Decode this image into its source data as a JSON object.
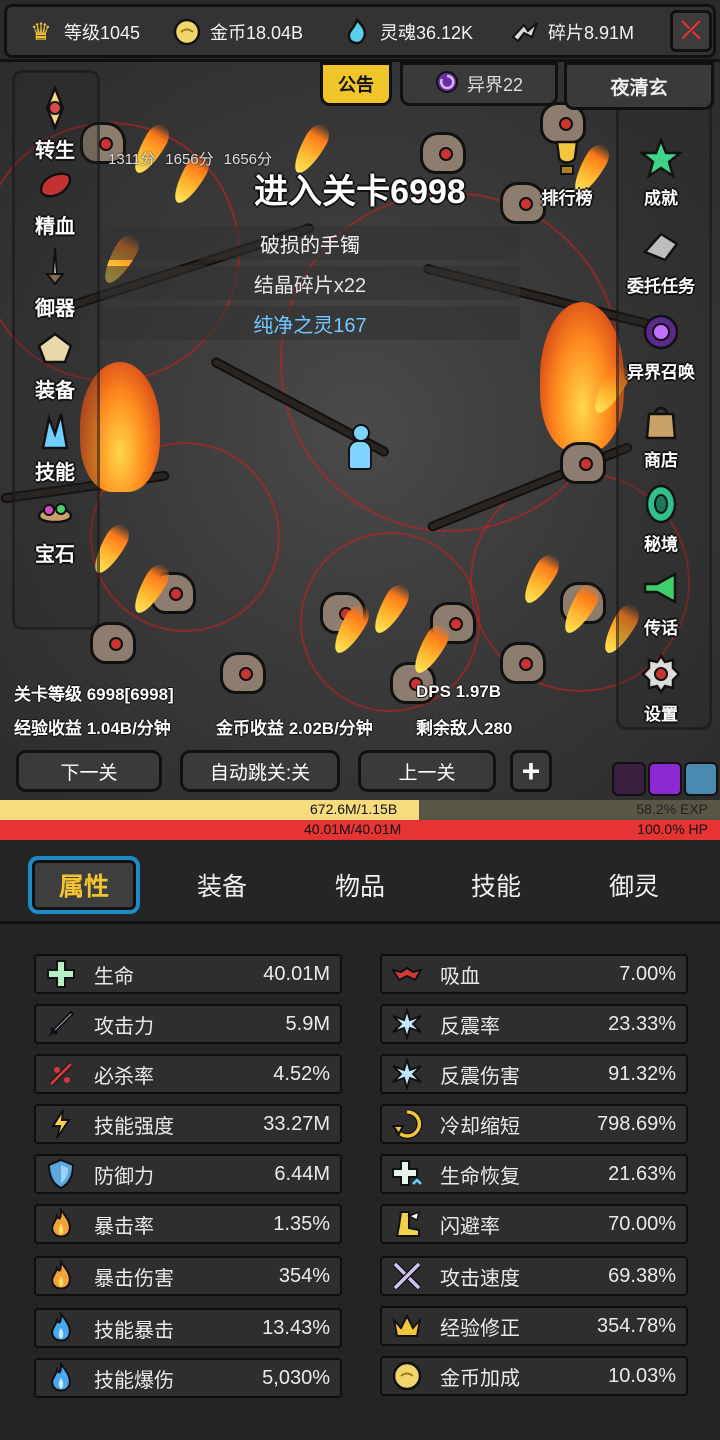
{
  "topbar": {
    "level": {
      "label": "等级1045",
      "icon": "crown-icon"
    },
    "gold": {
      "label": "金币18.04B",
      "icon": "gold-coin-icon"
    },
    "soul": {
      "label": "灵魂36.12K",
      "icon": "soul-flame-icon"
    },
    "shards": {
      "label": "碎片8.91M",
      "icon": "shard-icon"
    },
    "exit_icon": "exit-icon"
  },
  "scene": {
    "notice_label": "公告",
    "realm_label": "异界22",
    "player_name": "夜清玄",
    "scores": [
      "1311分",
      "1656分",
      "1656分"
    ],
    "stage_title": "进入关卡6998",
    "drops": [
      "破损的手镯",
      "结晶碎片x22",
      "纯净之灵167"
    ],
    "left_menu": [
      {
        "label": "转生",
        "icon": "rebirth-icon"
      },
      {
        "label": "精血",
        "icon": "blood-essence-icon"
      },
      {
        "label": "御器",
        "icon": "artifact-icon"
      },
      {
        "label": "装备",
        "icon": "equipment-icon"
      },
      {
        "label": "技能",
        "icon": "skill-crystal-icon"
      },
      {
        "label": "宝石",
        "icon": "gem-icon"
      }
    ],
    "right_menu": [
      {
        "label": "排行榜",
        "icon": "trophy-icon"
      },
      {
        "label": "成就",
        "icon": "star-icon"
      },
      {
        "label": "委托任务",
        "icon": "quest-icon"
      },
      {
        "label": "异界召唤",
        "icon": "portal-icon"
      },
      {
        "label": "商店",
        "icon": "shop-bag-icon"
      },
      {
        "label": "秘境",
        "icon": "secret-realm-icon"
      },
      {
        "label": "传话",
        "icon": "megaphone-icon"
      },
      {
        "label": "设置",
        "icon": "settings-gear-icon"
      }
    ],
    "stage_level": "关卡等级 6998[6998]",
    "dps": "DPS 1.97B",
    "exp_rate": "经验收益 1.04B/分钟",
    "gold_rate": "金币收益 2.02B/分钟",
    "enemies_left": "剩余敌人280",
    "next_stage": "下一关",
    "auto_skip": "自动跳关:关",
    "prev_stage": "上一关",
    "plus_label": "+"
  },
  "bars": {
    "exp_text": "672.6M/1.15B",
    "exp_pct_text": "58.2% EXP",
    "exp_fraction": 0.582,
    "hp_text": "40.01M/40.01M",
    "hp_pct_text": "100.0%  HP",
    "hp_fraction": 1.0
  },
  "tabs": [
    "属性",
    "装备",
    "物品",
    "技能",
    "御灵"
  ],
  "active_tab": "属性",
  "stats_left": [
    {
      "label": "生命",
      "value": "40.01M",
      "icon": "health-cross-icon"
    },
    {
      "label": "攻击力",
      "value": "5.9M",
      "icon": "sword-icon"
    },
    {
      "label": "必杀率",
      "value": "4.52%",
      "icon": "critical-slash-icon"
    },
    {
      "label": "技能强度",
      "value": "33.27M",
      "icon": "lightning-icon"
    },
    {
      "label": "防御力",
      "value": "6.44M",
      "icon": "shield-icon"
    },
    {
      "label": "暴击率",
      "value": "1.35%",
      "icon": "flame-icon"
    },
    {
      "label": "暴击伤害",
      "value": "354%",
      "icon": "flame-icon"
    },
    {
      "label": "技能暴击",
      "value": "13.43%",
      "icon": "blue-flame-icon"
    },
    {
      "label": "技能爆伤",
      "value": "5,030%",
      "icon": "blue-flame-icon"
    }
  ],
  "stats_right": [
    {
      "label": "吸血",
      "value": "7.00%",
      "icon": "bat-icon"
    },
    {
      "label": "反震率",
      "value": "23.33%",
      "icon": "ice-burst-icon"
    },
    {
      "label": "反震伤害",
      "value": "91.32%",
      "icon": "ice-burst-icon"
    },
    {
      "label": "冷却缩短",
      "value": "798.69%",
      "icon": "cooldown-icon"
    },
    {
      "label": "生命恢复",
      "value": "21.63%",
      "icon": "regen-cross-icon"
    },
    {
      "label": "闪避率",
      "value": "70.00%",
      "icon": "winged-boot-icon"
    },
    {
      "label": "攻击速度",
      "value": "69.38%",
      "icon": "crossed-swords-icon"
    },
    {
      "label": "经验修正",
      "value": "354.78%",
      "icon": "crown-icon"
    },
    {
      "label": "金币加成",
      "value": "10.03%",
      "icon": "gold-coin-icon"
    }
  ],
  "colors": {
    "accent_gold": "#f4c430",
    "tab_border": "#1b8cc8",
    "exp_fill": "#f7dc7e",
    "hp_fill": "#e63333"
  }
}
